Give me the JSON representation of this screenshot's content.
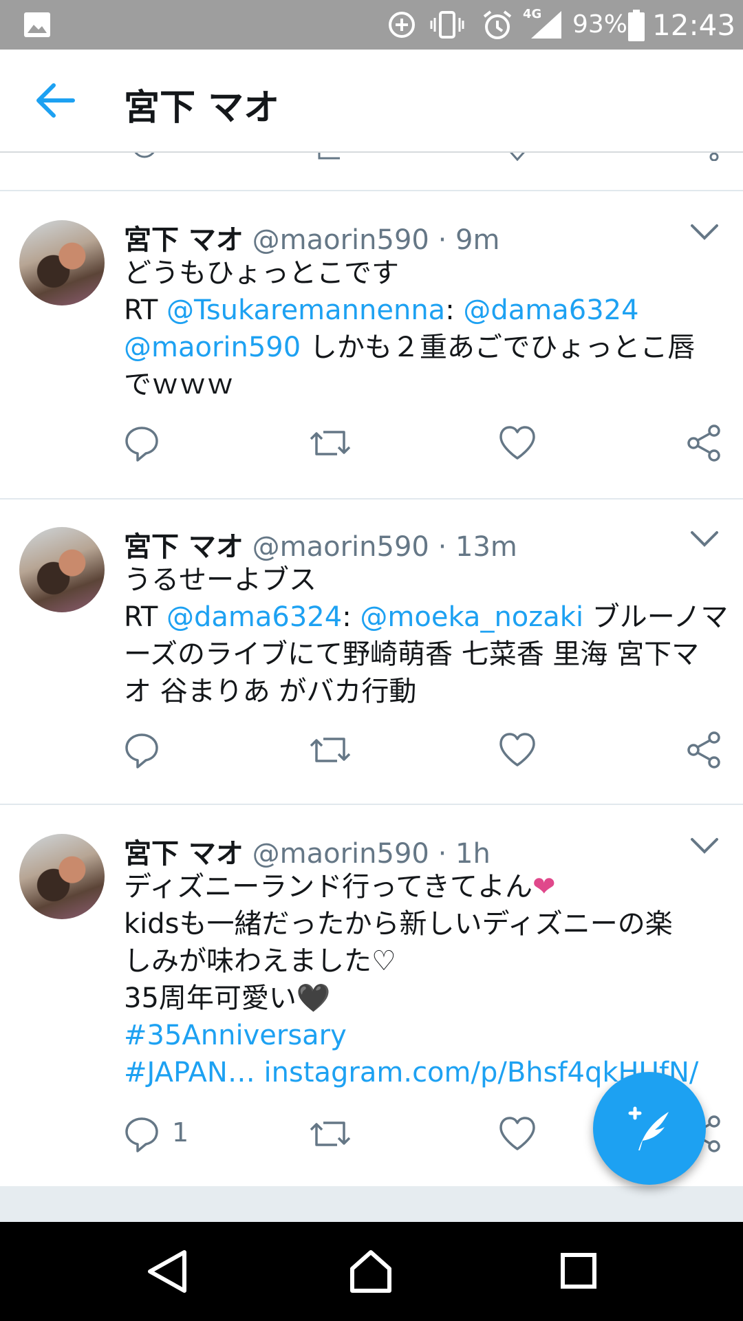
{
  "status_bar": {
    "battery_percent": "93%",
    "time": "12:43",
    "network": "4G",
    "icons": [
      "gallery-icon",
      "data-saver-icon",
      "vibrate-icon",
      "alarm-icon",
      "signal-icon",
      "battery-icon"
    ]
  },
  "app_bar": {
    "title": "宮下 マオ",
    "back_icon": "arrow-left-icon"
  },
  "tweets": [
    {
      "name": "宮下 マオ",
      "handle": "@maorin590",
      "dot": "·",
      "time": "9m",
      "lines": [
        [
          {
            "text": "どうもひょっとこです",
            "link": false
          }
        ],
        [
          {
            "text": "RT ",
            "link": false
          },
          {
            "text": "@Tsukaremannenna",
            "link": true
          },
          {
            "text": ": ",
            "link": false
          },
          {
            "text": "@dama6324",
            "link": true
          }
        ],
        [
          {
            "text": "@maorin590",
            "link": true
          },
          {
            "text": " しかも２重あごでひょっとこ唇",
            "link": false
          }
        ],
        [
          {
            "text": "でｗｗｗ",
            "link": false
          }
        ]
      ]
    },
    {
      "name": "宮下 マオ",
      "handle": "@maorin590",
      "dot": "·",
      "time": "13m",
      "lines": [
        [
          {
            "text": "うるせーよブス",
            "link": false
          }
        ],
        [
          {
            "text": "RT ",
            "link": false
          },
          {
            "text": "@dama6324",
            "link": true
          },
          {
            "text": ": ",
            "link": false
          },
          {
            "text": "@moeka_nozaki",
            "link": true
          },
          {
            "text": " ブルーノマ",
            "link": false
          }
        ],
        [
          {
            "text": "ーズのライブにて野崎萌香 七菜香 里海 宮下マ",
            "link": false
          }
        ],
        [
          {
            "text": "オ 谷まりあ がバカ行動",
            "link": false
          }
        ]
      ]
    },
    {
      "name": "宮下 マオ",
      "handle": "@maorin590",
      "dot": "·",
      "time": "1h",
      "reply_count": "1",
      "lines": [
        [
          {
            "text": "ディズニーランド行ってきてよん",
            "link": false
          },
          {
            "text": "❤",
            "link": false,
            "pink": true
          }
        ],
        [
          {
            "text": "kidsも一緒だったから新しいディズニーの楽",
            "link": false
          }
        ],
        [
          {
            "text": "しみが味わえました♡",
            "link": false
          }
        ],
        [
          {
            "text": "35周年可愛い",
            "link": false
          },
          {
            "text": "🖤",
            "link": false
          }
        ],
        [
          {
            "text": "#35Anniversary",
            "link": true
          }
        ],
        [
          {
            "text": "#JAPAN… instagram.com/p/Bhsf4qkHUfN/",
            "link": true
          }
        ]
      ]
    }
  ],
  "colors": {
    "link": "#1da1f2",
    "heart_pink": "#e0488b",
    "secondary_text": "#657786"
  }
}
